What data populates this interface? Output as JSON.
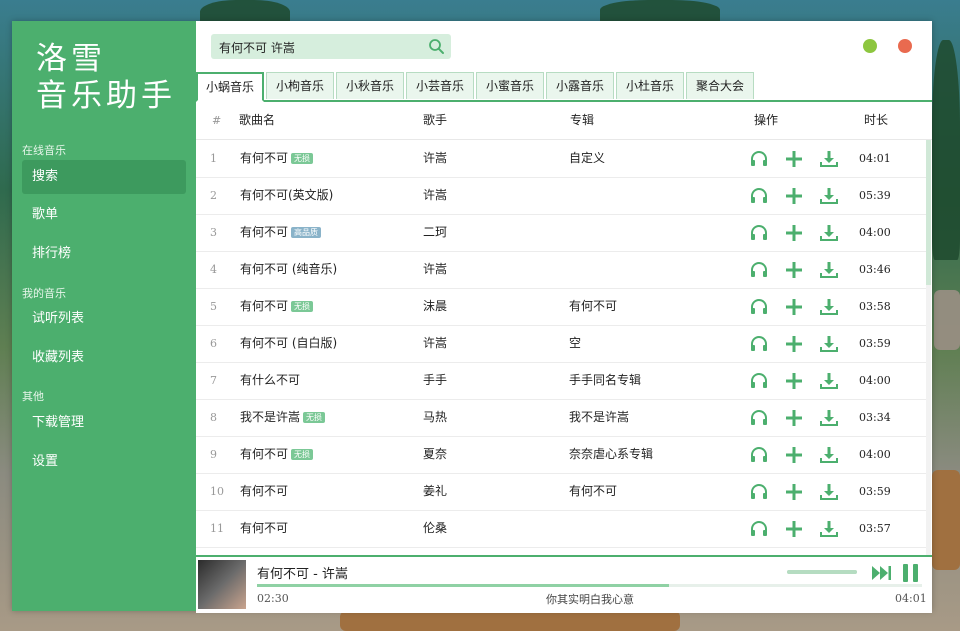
{
  "sidebar": {
    "logo_line1": "洛雪",
    "logo_line2": "音乐助手",
    "sections": [
      {
        "title": "在线音乐",
        "items": [
          {
            "label": "搜索",
            "active": true
          },
          {
            "label": "歌单"
          },
          {
            "label": "排行榜"
          }
        ]
      },
      {
        "title": "我的音乐",
        "items": [
          {
            "label": "试听列表"
          },
          {
            "label": "收藏列表"
          }
        ]
      },
      {
        "title": "其他",
        "items": [
          {
            "label": "下载管理"
          },
          {
            "label": "设置"
          }
        ]
      }
    ]
  },
  "search": {
    "value": "有何不可 许嵩",
    "icon": "search-icon"
  },
  "window_controls": {
    "minimize_color": "#8dc63f",
    "close_color": "#e96a4f"
  },
  "tabs": [
    {
      "label": "小蜗音乐",
      "active": true
    },
    {
      "label": "小枸音乐"
    },
    {
      "label": "小秋音乐"
    },
    {
      "label": "小芸音乐"
    },
    {
      "label": "小蜜音乐"
    },
    {
      "label": "小露音乐"
    },
    {
      "label": "小杜音乐"
    },
    {
      "label": "聚合大会"
    }
  ],
  "table": {
    "headers": {
      "index": "#",
      "name": "歌曲名",
      "singer": "歌手",
      "album": "专辑",
      "actions": "操作",
      "duration": "时长"
    },
    "rows": [
      {
        "index": "1",
        "name": "有何不可",
        "badge": "无损",
        "badge_color": "#7bc896",
        "singer": "许嵩",
        "album": "自定义",
        "duration": "04:01"
      },
      {
        "index": "2",
        "name": "有何不可(英文版)",
        "badge": "",
        "singer": "许嵩",
        "album": "",
        "duration": "05:39"
      },
      {
        "index": "3",
        "name": "有何不可",
        "badge": "高品质",
        "badge_color": "#8ab3c9",
        "singer": "二珂",
        "album": "",
        "duration": "04:00"
      },
      {
        "index": "4",
        "name": "有何不可 (纯音乐)",
        "badge": "",
        "singer": "许嵩",
        "album": "",
        "duration": "03:46"
      },
      {
        "index": "5",
        "name": "有何不可",
        "badge": "无损",
        "badge_color": "#7bc896",
        "singer": "沫晨",
        "album": "有何不可",
        "duration": "03:58"
      },
      {
        "index": "6",
        "name": "有何不可 (自白版)",
        "badge": "",
        "singer": "许嵩",
        "album": "空",
        "duration": "03:59"
      },
      {
        "index": "7",
        "name": "有什么不可",
        "badge": "",
        "singer": "手手",
        "album": "手手同名专辑",
        "duration": "04:00"
      },
      {
        "index": "8",
        "name": "我不是许嵩",
        "badge": "无损",
        "badge_color": "#7bc896",
        "singer": "马热",
        "album": "我不是许嵩",
        "duration": "03:34"
      },
      {
        "index": "9",
        "name": "有何不可",
        "badge": "无损",
        "badge_color": "#7bc896",
        "singer": "夏奈",
        "album": "奈奈虐心系专辑",
        "duration": "04:00"
      },
      {
        "index": "10",
        "name": "有何不可",
        "badge": "",
        "singer": "姜礼",
        "album": "有何不可",
        "duration": "03:59"
      },
      {
        "index": "11",
        "name": "有何不可",
        "badge": "",
        "singer": "伦桑",
        "album": "",
        "duration": "03:57"
      }
    ]
  },
  "player": {
    "title": "有何不可 - 许嵩",
    "current_time": "02:30",
    "total_time": "04:01",
    "lyric": "你其实明白我心意",
    "progress_fraction": 0.62,
    "volume_fraction": 1.0,
    "accent": "#4caf6e"
  }
}
